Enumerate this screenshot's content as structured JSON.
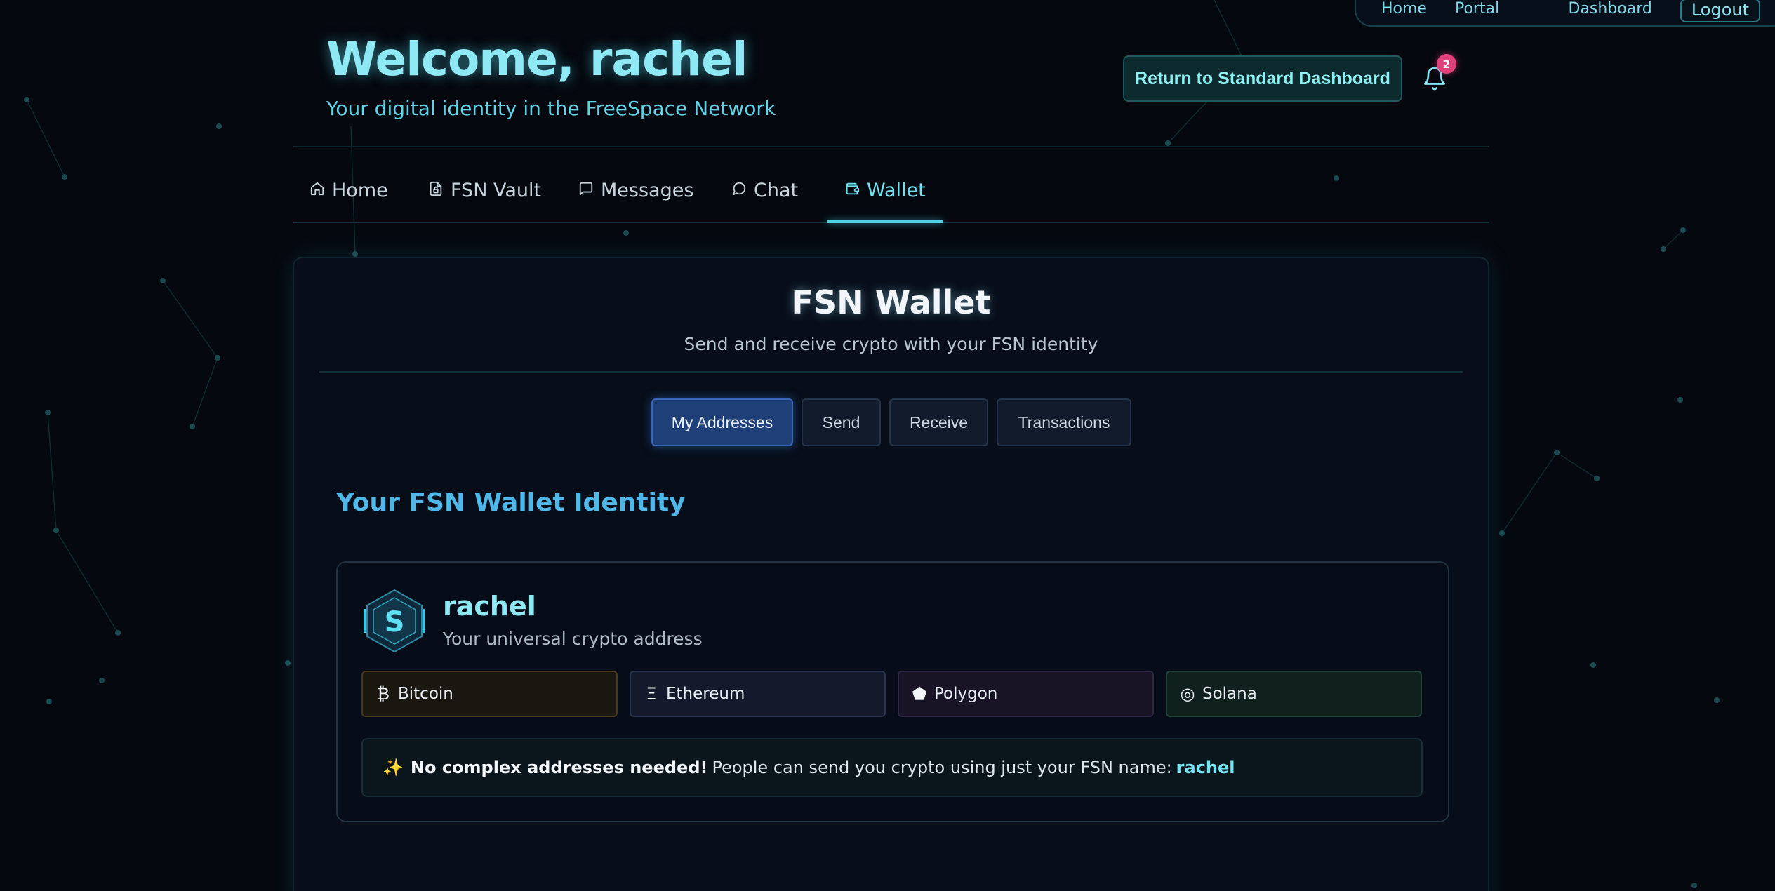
{
  "colors": {
    "accent": "#6ee3f0",
    "background": "#05080f",
    "notification": "#e0417a",
    "active_tab": "#1f3f78"
  },
  "top_nav": {
    "links": [
      "Home",
      "Admin Portal",
      "Dashboard"
    ],
    "logout_label": "Logout"
  },
  "header": {
    "welcome": "Welcome, rachel",
    "subtitle": "Your digital identity in the FreeSpace Network",
    "return_button": "Return to Standard Dashboard",
    "notification_count": "2",
    "bell_icon": "bell-icon"
  },
  "main_tabs": [
    {
      "label": "Home",
      "icon": "home-icon"
    },
    {
      "label": "FSN Vault",
      "icon": "file-lock-icon"
    },
    {
      "label": "Messages",
      "icon": "message-square-icon"
    },
    {
      "label": "Chat",
      "icon": "message-circle-icon"
    },
    {
      "label": "Wallet",
      "icon": "wallet-icon",
      "active": true
    }
  ],
  "wallet": {
    "title": "FSN Wallet",
    "subtitle": "Send and receive crypto with your FSN identity",
    "sub_tabs": [
      "My Addresses",
      "Send",
      "Receive",
      "Transactions"
    ],
    "active_sub_tab": "My Addresses",
    "identity_heading": "Your FSN Wallet Identity",
    "identity": {
      "name": "rachel",
      "description": "Your universal crypto address",
      "avatar_letter": "S",
      "chains": [
        {
          "label": "Bitcoin",
          "glyph": "₿",
          "icon": "bitcoin-icon"
        },
        {
          "label": "Ethereum",
          "glyph": "Ξ",
          "icon": "ethereum-icon"
        },
        {
          "label": "Polygon",
          "glyph": "⬟",
          "icon": "polygon-icon"
        },
        {
          "label": "Solana",
          "glyph": "◎",
          "icon": "solana-icon"
        }
      ],
      "notice": {
        "emoji": "✨",
        "bold": "No complex addresses needed!",
        "text": "People can send you crypto using just your FSN name:",
        "fsn_name": "rachel"
      }
    }
  }
}
